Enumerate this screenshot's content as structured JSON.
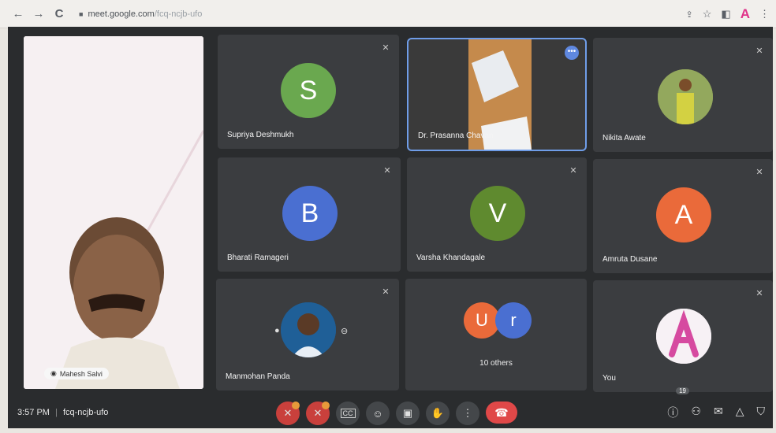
{
  "browser": {
    "back_icon": "←",
    "forward_icon": "→",
    "reload_icon": "C",
    "url_host": "meet.google.com",
    "url_path": "/fcq-ncjb-ufo",
    "right_icons": [
      "share-icon",
      "star-icon",
      "panel-icon",
      "profile-a",
      "menu-icon"
    ],
    "profile_letter": "A"
  },
  "meeting": {
    "pinned_name": "Mahesh Salvi",
    "time": "3:57 PM",
    "separator": "|",
    "code": "fcq-ncjb-ufo",
    "participant_count": "19",
    "tiles": [
      {
        "name": "Supriya Deshmukh",
        "initial": "S",
        "color": "#6aa84f"
      },
      {
        "name": "Dr. Prasanna Chavan",
        "initial": "",
        "color": ""
      },
      {
        "name": "Nikita Awate",
        "initial": "",
        "color": ""
      },
      {
        "name": "Bharati Ramageri",
        "initial": "B",
        "color": "#4a6fd1"
      },
      {
        "name": "Varsha Khandagale",
        "initial": "V",
        "color": "#5f8a2f"
      },
      {
        "name": "Amruta Dusane",
        "initial": "A",
        "color": "#ea6a3a"
      },
      {
        "name": "Manmohan Panda",
        "initial": "",
        "color": ""
      },
      {
        "name": "10 others",
        "initial": "",
        "color": ""
      },
      {
        "name": "You",
        "initial": "",
        "color": ""
      }
    ],
    "others_initials": [
      "U",
      "r"
    ],
    "others_colors": [
      "#ea6a3a",
      "#4a6fd1"
    ]
  },
  "controls": {
    "mic_icon": "mic-off-icon",
    "cam_icon": "cam-off-icon",
    "cc_label": "CC",
    "emoji_icon": "☺",
    "present_icon": "▣",
    "raise_hand_icon": "✋",
    "more_icon": "⋮",
    "hangup_icon": "☎",
    "info_icon": "ⓘ",
    "people_icon": "👥",
    "chat_icon": "✉",
    "activities_icon": "△",
    "lock_icon": "🔒"
  }
}
